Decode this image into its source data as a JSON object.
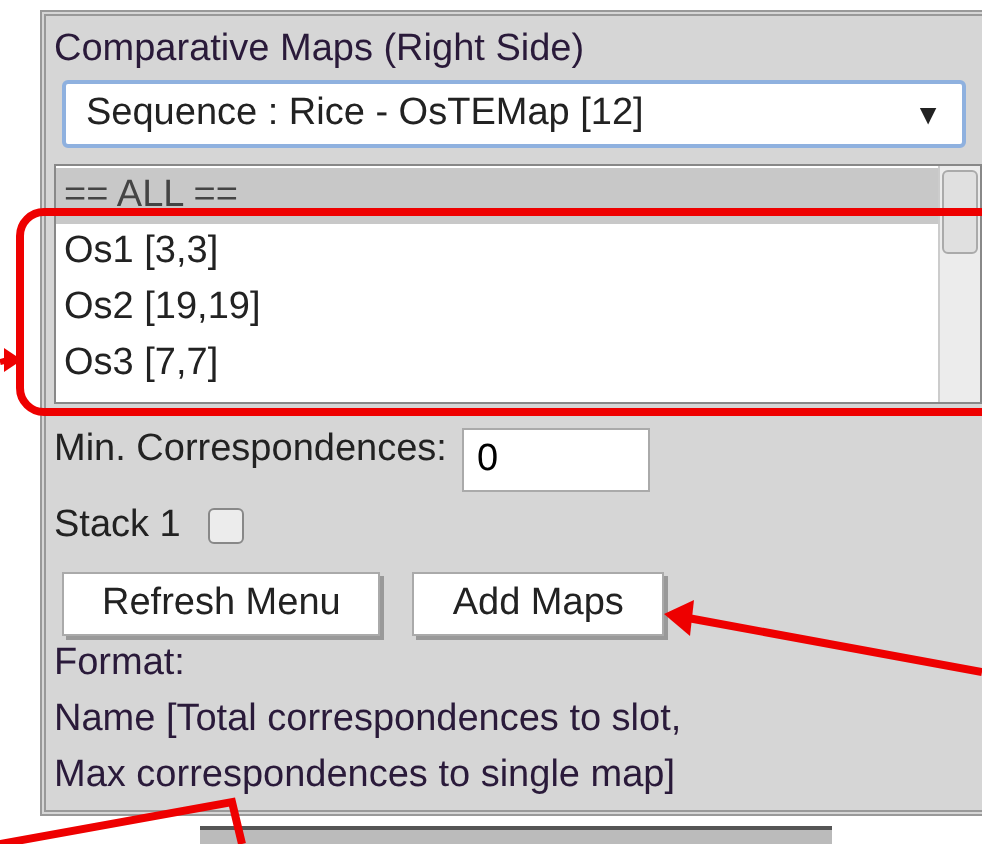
{
  "panel": {
    "title": "Comparative Maps (Right Side)",
    "map_select": {
      "value": "Sequence : Rice - OsTEMap [12]",
      "arrow": "▼"
    },
    "map_list": [
      {
        "label": "== ALL ==",
        "selected": true
      },
      {
        "label": "Os1 [3,3]",
        "selected": false
      },
      {
        "label": "Os2 [19,19]",
        "selected": false
      },
      {
        "label": "Os3 [7,7]",
        "selected": false
      }
    ],
    "min_correspondences": {
      "label": "Min. Correspondences:",
      "value": "0"
    },
    "stack": {
      "label": "Stack 1",
      "checked": false
    },
    "buttons": [
      "Refresh Menu",
      "Add Maps"
    ],
    "format_lines": [
      "Format:",
      "Name [Total correspondences to slot,",
      "Max correspondences to single map]"
    ]
  }
}
